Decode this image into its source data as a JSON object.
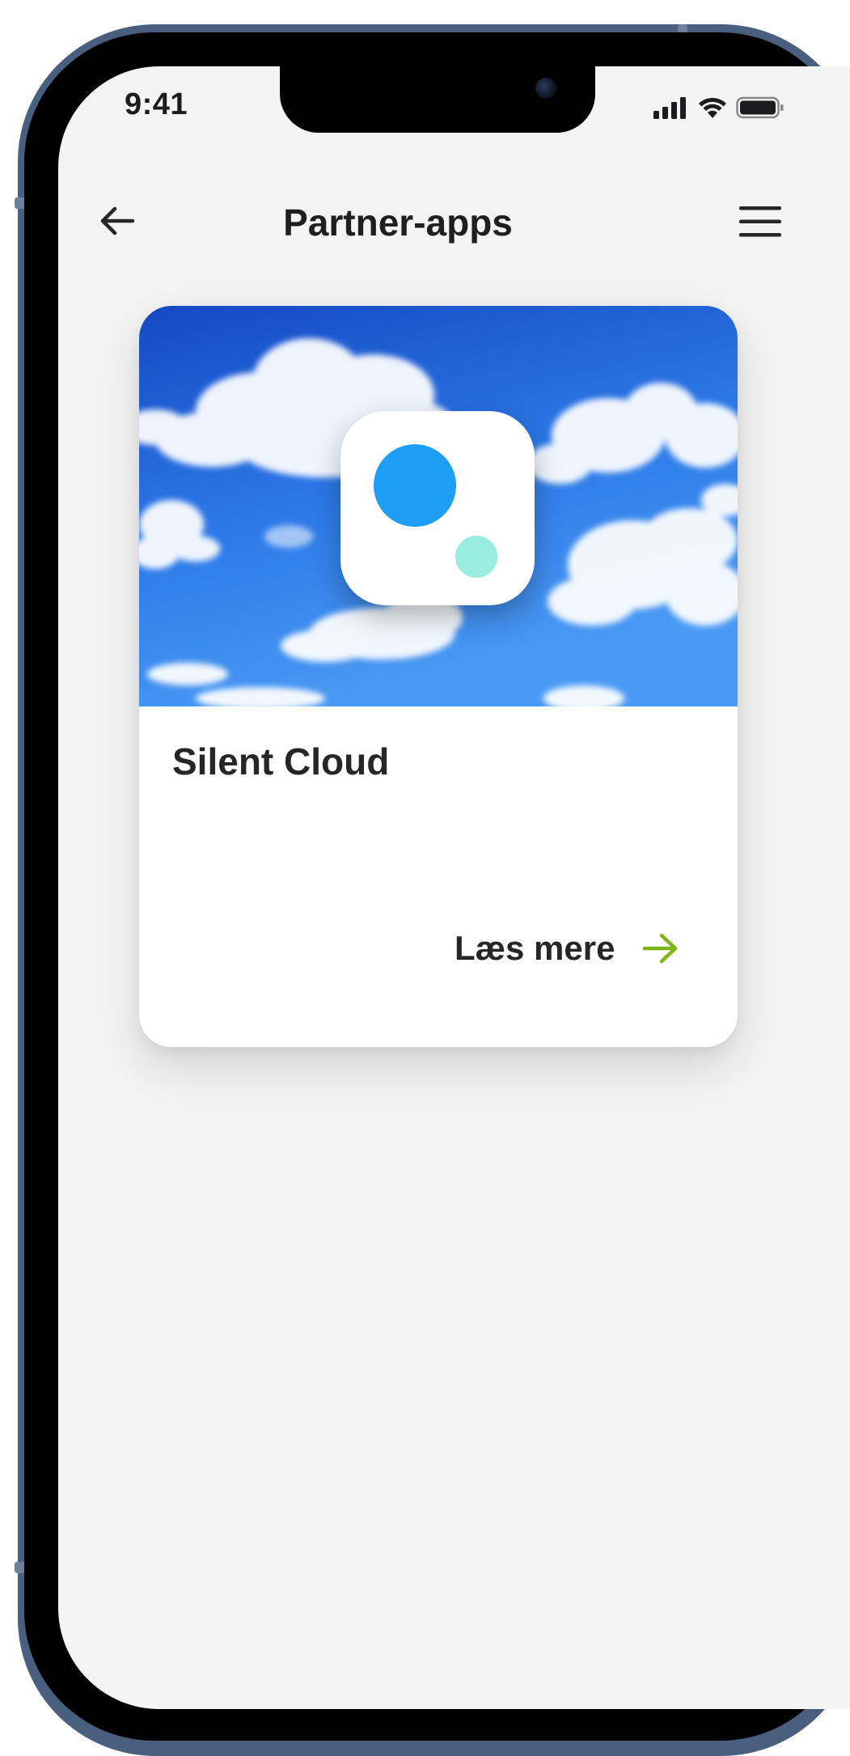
{
  "status_bar": {
    "time": "9:41",
    "icons": [
      "cellular-signal-icon",
      "wifi-icon",
      "battery-icon"
    ]
  },
  "header": {
    "title": "Partner-apps",
    "back_icon": "arrow-left-icon",
    "menu_icon": "hamburger-menu-icon"
  },
  "card": {
    "title": "Silent Cloud",
    "app_icon": "silent-cloud-app-icon",
    "hero_image": "sky-clouds-image",
    "link_label": "Læs mere",
    "link_icon": "arrow-right-icon"
  },
  "colors": {
    "background": "#f4f4f4",
    "device_frame": "#4a5f7e",
    "accent_arrow": "#7cb518",
    "app_dot_primary": "#1e9ff6",
    "app_dot_secondary": "#98ece0",
    "sky_top": "#1a5fd0",
    "sky_bottom": "#3b8ff0"
  }
}
